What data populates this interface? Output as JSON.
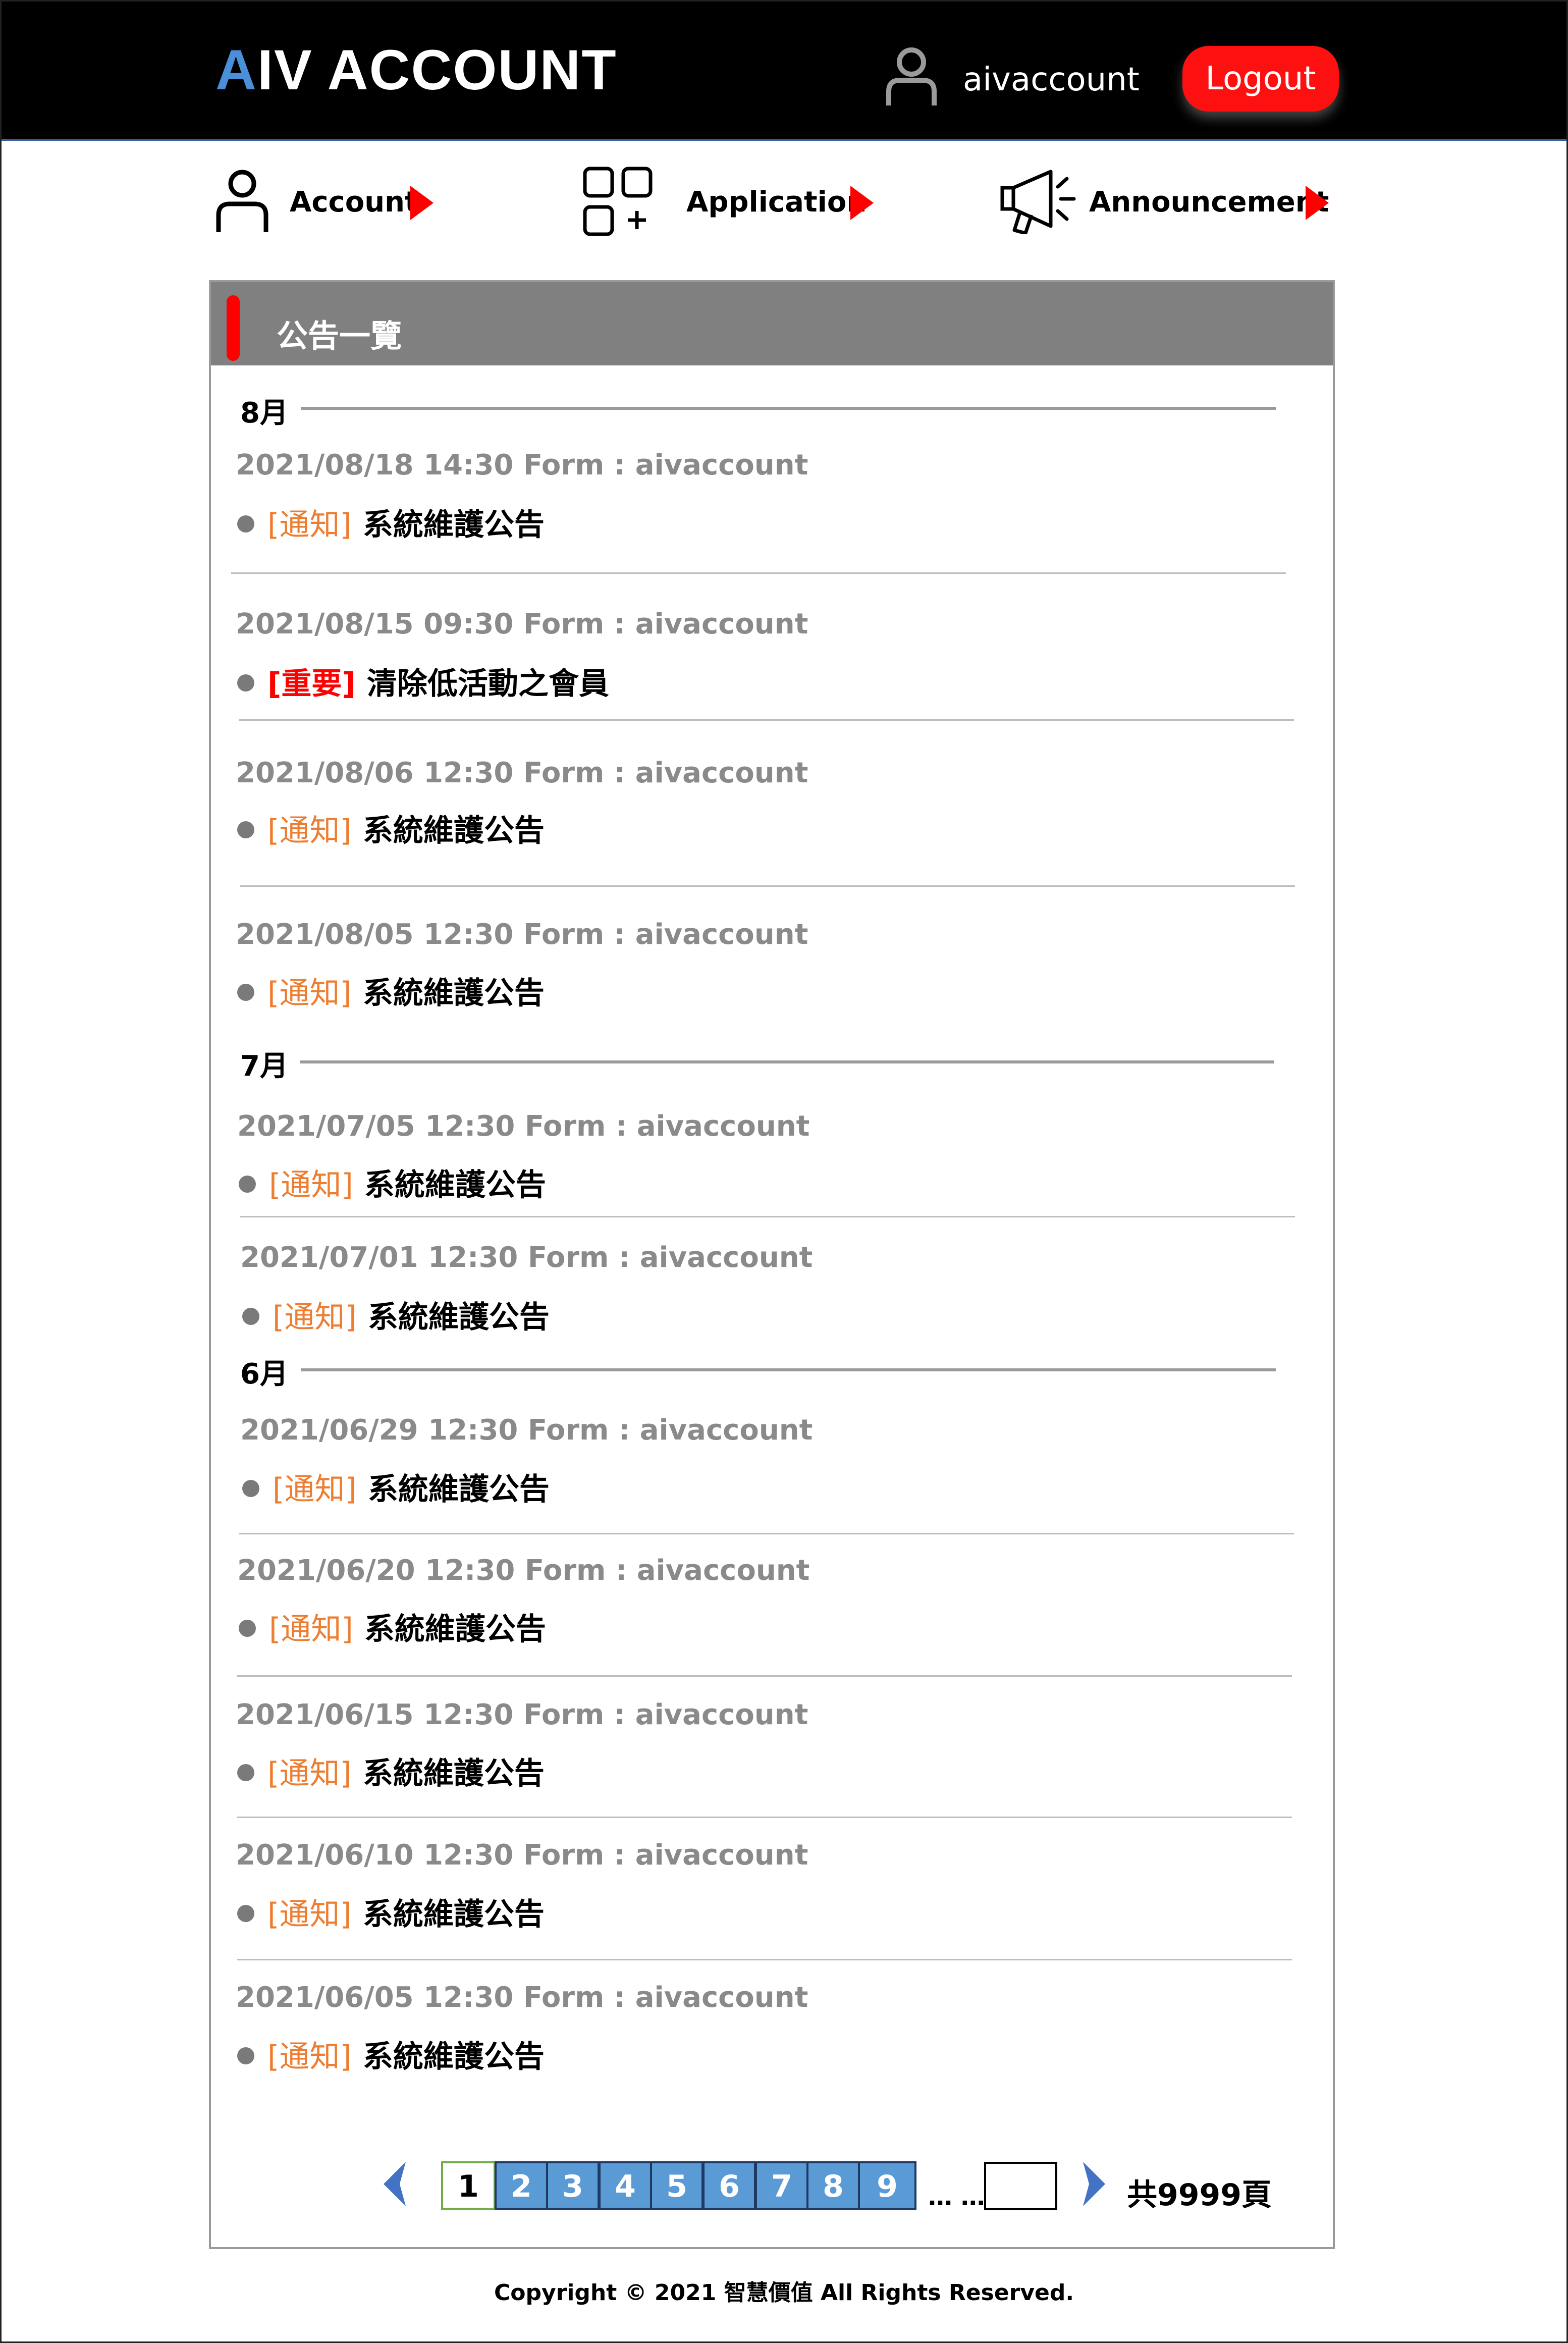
{
  "header": {
    "brand_first": "A",
    "brand_rest": "IV ACCOUNT",
    "username": "aivaccount",
    "logout_label": "Logout"
  },
  "nav": {
    "items": [
      {
        "label": "Account",
        "icon": "user-icon"
      },
      {
        "label": "Application",
        "icon": "apps-add-icon"
      },
      {
        "label": "Announcement",
        "icon": "megaphone-icon"
      }
    ]
  },
  "panel": {
    "title": "公告一覽",
    "months": [
      "8月",
      "7月",
      "6月"
    ],
    "announcements": [
      {
        "date": "2021/08/18  14:30",
        "from": "Form : aivaccount",
        "tag": "[通知]",
        "title": "系統維護公告"
      },
      {
        "date": "2021/08/15  09:30",
        "from": "Form : aivaccount",
        "tag": "[重要]",
        "title": "清除低活動之會員"
      },
      {
        "date": "2021/08/06  12:30",
        "from": "Form : aivaccount",
        "tag": "[通知]",
        "title": "系統維護公告"
      },
      {
        "date": "2021/08/05  12:30",
        "from": "Form : aivaccount",
        "tag": "[通知]",
        "title": "系統維護公告"
      },
      {
        "date": "2021/07/05  12:30",
        "from": "Form : aivaccount",
        "tag": "[通知]",
        "title": "系統維護公告"
      },
      {
        "date": "2021/07/01  12:30",
        "from": "Form : aivaccount",
        "tag": "[通知]",
        "title": "系統維護公告"
      },
      {
        "date": "2021/06/29  12:30",
        "from": "Form : aivaccount",
        "tag": "[通知]",
        "title": "系統維護公告"
      },
      {
        "date": "2021/06/20  12:30",
        "from": "Form : aivaccount",
        "tag": "[通知]",
        "title": "系統維護公告"
      },
      {
        "date": "2021/06/15  12:30",
        "from": "Form : aivaccount",
        "tag": "[通知]",
        "title": "系統維護公告"
      },
      {
        "date": "2021/06/10  12:30",
        "from": "Form : aivaccount",
        "tag": "[通知]",
        "title": "系統維護公告"
      },
      {
        "date": "2021/06/05  12:30",
        "from": "Form : aivaccount",
        "tag": "[通知]",
        "title": "系統維護公告"
      }
    ]
  },
  "pagination": {
    "pages": [
      "1",
      "2",
      "3",
      "4",
      "5",
      "6",
      "7",
      "8",
      "9"
    ],
    "current_page": "1",
    "ellipsis": "… …",
    "jump_value": "",
    "total": "共9999頁"
  },
  "colors": {
    "header_bg": "#000000",
    "brand_accent": "#4a90d9",
    "logout_bg": "#ff1010",
    "nav_arrow": "#ff0000",
    "panel_header_bg": "#808080",
    "tag_notice": "#ed7d31",
    "tag_important": "#ff0000",
    "page_button": "#5b9bd5"
  },
  "footer": {
    "copyright": "Copyright © 2021 智慧價值 All Rights Reserved."
  }
}
